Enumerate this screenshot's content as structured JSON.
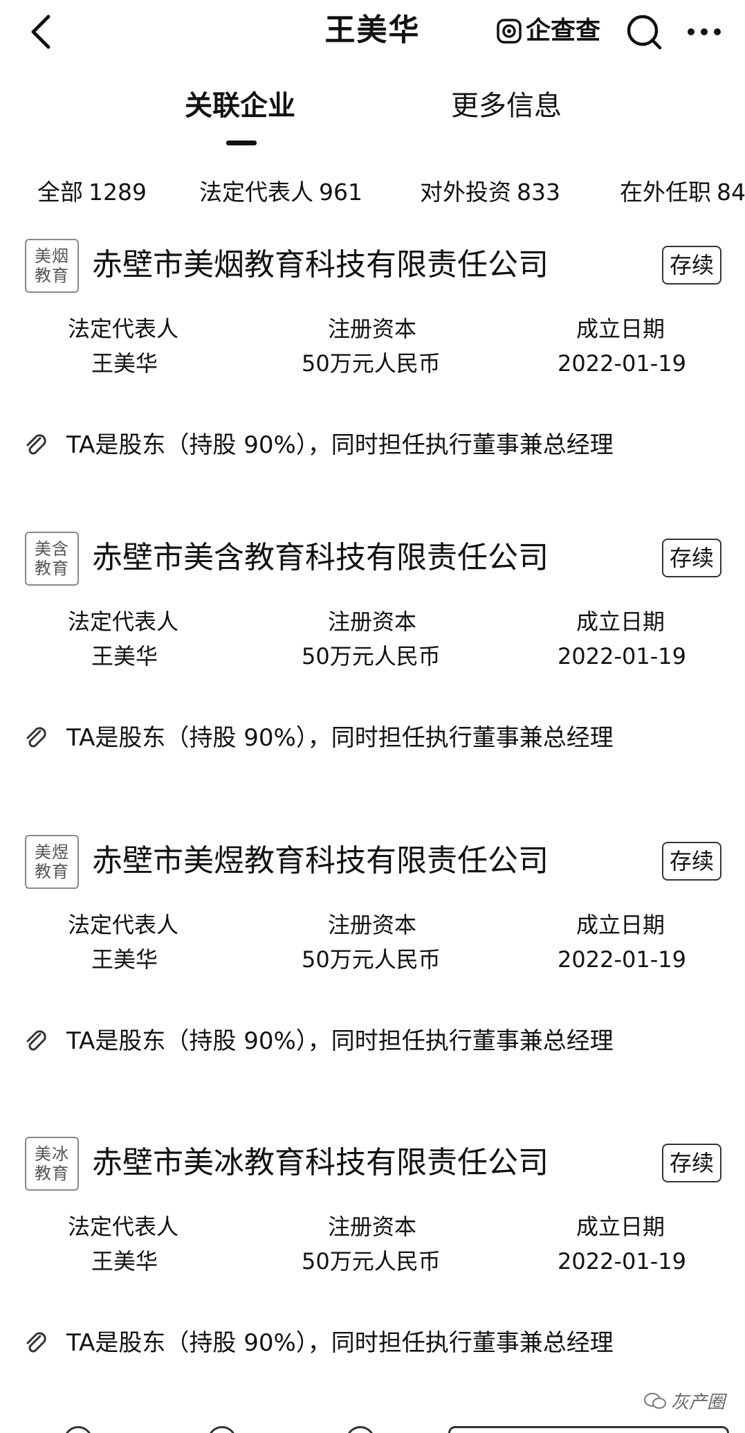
{
  "header": {
    "title": "王美华",
    "brand": "企查查"
  },
  "tabs": [
    {
      "label": "关联企业"
    },
    {
      "label": "更多信息"
    }
  ],
  "filters": [
    {
      "label": "全部",
      "count": "1289"
    },
    {
      "label": "法定代表人",
      "count": "961"
    },
    {
      "label": "对外投资",
      "count": "833"
    },
    {
      "label": "在外任职",
      "count": "84"
    }
  ],
  "field_labels": {
    "legal_rep": "法定代表人",
    "capital": "注册资本",
    "founded": "成立日期"
  },
  "companies": [
    {
      "logo_text": "美烟教育",
      "name": "赤壁市美烟教育科技有限责任公司",
      "status": "存续",
      "legal_rep": "王美华",
      "capital": "50万元人民币",
      "founded": "2022-01-19",
      "relation": "TA是股东（持股 90%），同时担任执行董事兼总经理"
    },
    {
      "logo_text": "美含教育",
      "name": "赤壁市美含教育科技有限责任公司",
      "status": "存续",
      "legal_rep": "王美华",
      "capital": "50万元人民币",
      "founded": "2022-01-19",
      "relation": "TA是股东（持股 90%），同时担任执行董事兼总经理"
    },
    {
      "logo_text": "美煜教育",
      "name": "赤壁市美煜教育科技有限责任公司",
      "status": "存续",
      "legal_rep": "王美华",
      "capital": "50万元人民币",
      "founded": "2022-01-19",
      "relation": "TA是股东（持股 90%），同时担任执行董事兼总经理"
    },
    {
      "logo_text": "美冰教育",
      "name": "赤壁市美冰教育科技有限责任公司",
      "status": "存续",
      "legal_rep": "王美华",
      "capital": "50万元人民币",
      "founded": "2022-01-19",
      "relation": "TA是股东（持股 90%），同时担任执行董事兼总经理"
    }
  ],
  "watermark": "灰产圈",
  "icons": {
    "back": "chevron-left-icon",
    "search": "search-icon",
    "more": "more-dots-icon",
    "relation": "paperclip-icon",
    "brand_logo": "qcc-logo-icon"
  }
}
